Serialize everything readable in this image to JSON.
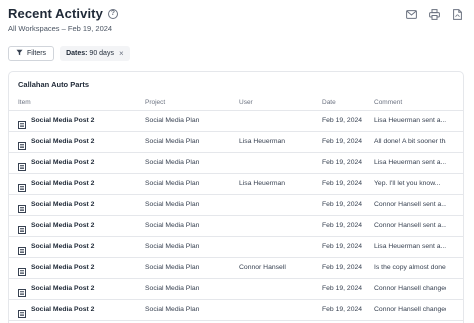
{
  "header": {
    "title": "Recent Activity",
    "help_glyph": "?",
    "subtitle": "All Workspaces – Feb 19, 2024"
  },
  "toolbar": {
    "actions": [
      "mail-icon",
      "print-icon",
      "pdf-icon"
    ]
  },
  "filters": {
    "filters_label": "Filters",
    "chip_key": "Dates:",
    "chip_value": "90 days",
    "chip_close": "×"
  },
  "panel": {
    "title": "Callahan Auto Parts",
    "columns": {
      "item": "Item",
      "project": "Project",
      "user": "User",
      "date": "Date",
      "comment": "Comment"
    },
    "rows": [
      {
        "item": "Social Media Post 2",
        "project": "Social Media Plan",
        "user": "",
        "date": "Feb 19, 2024",
        "comment": "Lisa Heuerman sent a..."
      },
      {
        "item": "Social Media Post 2",
        "project": "Social Media Plan",
        "user": "Lisa Heuerman",
        "date": "Feb 19, 2024",
        "comment": "All done! A bit sooner tha..."
      },
      {
        "item": "Social Media Post 2",
        "project": "Social Media Plan",
        "user": "",
        "date": "Feb 19, 2024",
        "comment": "Lisa Heuerman sent a..."
      },
      {
        "item": "Social Media Post 2",
        "project": "Social Media Plan",
        "user": "Lisa Heuerman",
        "date": "Feb 19, 2024",
        "comment": "Yep. I'll let you know..."
      },
      {
        "item": "Social Media Post 2",
        "project": "Social Media Plan",
        "user": "",
        "date": "Feb 19, 2024",
        "comment": "Connor Hansell sent a..."
      },
      {
        "item": "Social Media Post 2",
        "project": "Social Media Plan",
        "user": "",
        "date": "Feb 19, 2024",
        "comment": "Connor Hansell sent a..."
      },
      {
        "item": "Social Media Post 2",
        "project": "Social Media Plan",
        "user": "",
        "date": "Feb 19, 2024",
        "comment": "Lisa Heuerman sent a..."
      },
      {
        "item": "Social Media Post 2",
        "project": "Social Media Plan",
        "user": "Connor Hansell",
        "date": "Feb 19, 2024",
        "comment": "Is the copy almost done?"
      },
      {
        "item": "Social Media Post 2",
        "project": "Social Media Plan",
        "user": "",
        "date": "Feb 19, 2024",
        "comment": "Connor Hansell changed..."
      },
      {
        "item": "Social Media Post 2",
        "project": "Social Media Plan",
        "user": "",
        "date": "Feb 19, 2024",
        "comment": "Connor Hansell changed..."
      }
    ]
  }
}
